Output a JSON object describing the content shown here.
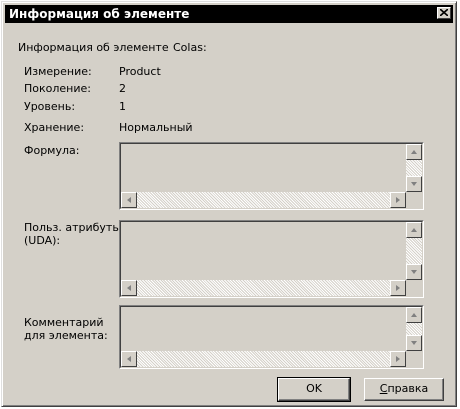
{
  "window": {
    "title": "Информация об элементе"
  },
  "header": {
    "label": "Информация об элементе",
    "member_name": "Colas:"
  },
  "info_rows": [
    {
      "label": "Измерение:",
      "value": "Product"
    },
    {
      "label": "Поколение:",
      "value": "2"
    },
    {
      "label": "Уровень:",
      "value": "1"
    },
    {
      "label": "Хранение:",
      "value": "Нормальный"
    }
  ],
  "fields": {
    "formula": {
      "label": "Формула:",
      "value": ""
    },
    "uda": {
      "label_line1": "Польз. атрибуты",
      "label_line2": "(UDA):",
      "value": ""
    },
    "comment": {
      "label_line1": "Комментарий",
      "label_line2": "для элемента:",
      "value": ""
    }
  },
  "buttons": {
    "ok": "OK",
    "help_first": "С",
    "help_rest": "правка"
  },
  "icons": [
    "close-icon",
    "scroll-up-icon",
    "scroll-down-icon",
    "scroll-left-icon",
    "scroll-right-icon"
  ]
}
